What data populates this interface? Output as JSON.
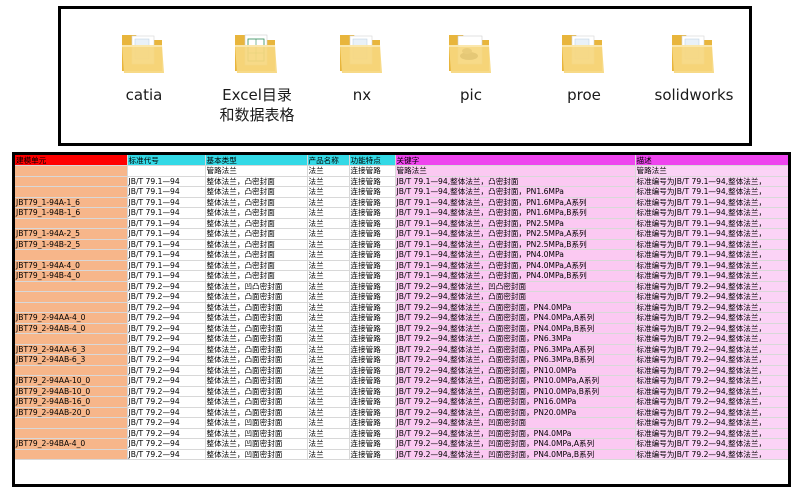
{
  "folders": [
    {
      "label": "catia",
      "icon": "folder-icon"
    },
    {
      "label": "Excel目录\n和数据表格",
      "icon": "folder-icon"
    },
    {
      "label": "nx",
      "icon": "folder-icon"
    },
    {
      "label": "pic",
      "icon": "folder-icon"
    },
    {
      "label": "proe",
      "icon": "folder-icon"
    },
    {
      "label": "solidworks",
      "icon": "folder-icon"
    }
  ],
  "colors": {
    "folder_back": "#e8b53c",
    "folder_front": "#f6d77e",
    "col_a_bg": "#f7b68a",
    "header_red": "#ff0000",
    "header_cyan": "#33d9e6",
    "header_magenta": "#ee44ee",
    "pink_bg": "#fbc9f2"
  },
  "sheet": {
    "headers": [
      "建模单元",
      "标准代号",
      "基本类型",
      "产品名称",
      "功能特点",
      "关键字",
      "描述"
    ],
    "rows": [
      [
        "",
        "",
        "管路法兰",
        "法兰",
        "连接管路",
        "管路法兰",
        "管路法兰"
      ],
      [
        "",
        "JB/T 79.1—94",
        "整体法兰，凸密封面",
        "法兰",
        "连接管路",
        "JB/T 79.1—94,整体法兰，凸密封面",
        "标准编号为JB/T 79.1—94,整体法兰，"
      ],
      [
        "",
        "JB/T 79.1—94",
        "整体法兰，凸密封面",
        "法兰",
        "连接管路",
        "JB/T 79.1—94,整体法兰，凸密封面，PN1.6MPa",
        "标准编号为JB/T 79.1—94,整体法兰，"
      ],
      [
        "JBT79_1-94A-1_6",
        "JB/T 79.1—94",
        "整体法兰，凸密封面",
        "法兰",
        "连接管路",
        "JB/T 79.1—94,整体法兰，凸密封面，PN1.6MPa,A系列",
        "标准编号为JB/T 79.1—94,整体法兰，"
      ],
      [
        "JBT79_1-94B-1_6",
        "JB/T 79.1—94",
        "整体法兰，凸密封面",
        "法兰",
        "连接管路",
        "JB/T 79.1—94,整体法兰，凸密封面，PN1.6MPa,B系列",
        "标准编号为JB/T 79.1—94,整体法兰，"
      ],
      [
        "",
        "JB/T 79.1—94",
        "整体法兰，凸密封面",
        "法兰",
        "连接管路",
        "JB/T 79.1—94,整体法兰，凸密封面，PN2.5MPa",
        "标准编号为JB/T 79.1—94,整体法兰，"
      ],
      [
        "JBT79_1-94A-2_5",
        "JB/T 79.1—94",
        "整体法兰，凸密封面",
        "法兰",
        "连接管路",
        "JB/T 79.1—94,整体法兰，凸密封面，PN2.5MPa,A系列",
        "标准编号为JB/T 79.1—94,整体法兰，"
      ],
      [
        "JBT79_1-94B-2_5",
        "JB/T 79.1—94",
        "整体法兰，凸密封面",
        "法兰",
        "连接管路",
        "JB/T 79.1—94,整体法兰，凸密封面，PN2.5MPa,B系列",
        "标准编号为JB/T 79.1—94,整体法兰，"
      ],
      [
        "",
        "JB/T 79.1—94",
        "整体法兰，凸密封面",
        "法兰",
        "连接管路",
        "JB/T 79.1—94,整体法兰，凸密封面，PN4.0MPa",
        "标准编号为JB/T 79.1—94,整体法兰，"
      ],
      [
        "JBT79_1-94A-4_0",
        "JB/T 79.1—94",
        "整体法兰，凸密封面",
        "法兰",
        "连接管路",
        "JB/T 79.1—94,整体法兰，凸密封面，PN4.0MPa,A系列",
        "标准编号为JB/T 79.1—94,整体法兰，"
      ],
      [
        "JBT79_1-94B-4_0",
        "JB/T 79.1—94",
        "整体法兰，凸密封面",
        "法兰",
        "连接管路",
        "JB/T 79.1—94,整体法兰，凸密封面，PN4.0MPa,B系列",
        "标准编号为JB/T 79.1—94,整体法兰，"
      ],
      [
        "",
        "JB/T 79.2—94",
        "整体法兰，凹凸密封面",
        "法兰",
        "连接管路",
        "JB/T 79.2—94,整体法兰，凹凸密封面",
        "标准编号为JB/T 79.2—94,整体法兰，"
      ],
      [
        "",
        "JB/T 79.2—94",
        "整体法兰，凸面密封面",
        "法兰",
        "连接管路",
        "JB/T 79.2—94,整体法兰，凸面密封面",
        "标准编号为JB/T 79.2—94,整体法兰，"
      ],
      [
        "",
        "JB/T 79.2—94",
        "整体法兰，凸面密封面",
        "法兰",
        "连接管路",
        "JB/T 79.2—94,整体法兰，凸面密封面，PN4.0MPa",
        "标准编号为JB/T 79.2—94,整体法兰，"
      ],
      [
        "JBT79_2-94AA-4_0",
        "JB/T 79.2—94",
        "整体法兰，凸面密封面",
        "法兰",
        "连接管路",
        "JB/T 79.2—94,整体法兰，凸面密封面，PN4.0MPa,A系列",
        "标准编号为JB/T 79.2—94,整体法兰，"
      ],
      [
        "JBT79_2-94AB-4_0",
        "JB/T 79.2—94",
        "整体法兰，凸面密封面",
        "法兰",
        "连接管路",
        "JB/T 79.2—94,整体法兰，凸面密封面，PN4.0MPa,B系列",
        "标准编号为JB/T 79.2—94,整体法兰，"
      ],
      [
        "",
        "JB/T 79.2—94",
        "整体法兰，凸面密封面",
        "法兰",
        "连接管路",
        "JB/T 79.2—94,整体法兰，凸面密封面，PN6.3MPa",
        "标准编号为JB/T 79.2—94,整体法兰，"
      ],
      [
        "JBT79_2-94AA-6_3",
        "JB/T 79.2—94",
        "整体法兰，凸面密封面",
        "法兰",
        "连接管路",
        "JB/T 79.2—94,整体法兰，凸面密封面，PN6.3MPa,A系列",
        "标准编号为JB/T 79.2—94,整体法兰，"
      ],
      [
        "JBT79_2-94AB-6_3",
        "JB/T 79.2—94",
        "整体法兰，凸面密封面",
        "法兰",
        "连接管路",
        "JB/T 79.2—94,整体法兰，凸面密封面，PN6.3MPa,B系列",
        "标准编号为JB/T 79.2—94,整体法兰，"
      ],
      [
        "",
        "JB/T 79.2—94",
        "整体法兰，凸面密封面",
        "法兰",
        "连接管路",
        "JB/T 79.2—94,整体法兰，凸面密封面，PN10.0MPa",
        "标准编号为JB/T 79.2—94,整体法兰，"
      ],
      [
        "JBT79_2-94AA-10_0",
        "JB/T 79.2—94",
        "整体法兰，凸面密封面",
        "法兰",
        "连接管路",
        "JB/T 79.2—94,整体法兰，凸面密封面，PN10.0MPa,A系列",
        "标准编号为JB/T 79.2—94,整体法兰，"
      ],
      [
        "JBT79_2-94AB-10_0",
        "JB/T 79.2—94",
        "整体法兰，凸面密封面",
        "法兰",
        "连接管路",
        "JB/T 79.2—94,整体法兰，凸面密封面，PN10.0MPa,B系列",
        "标准编号为JB/T 79.2—94,整体法兰，"
      ],
      [
        "JBT79_2-94AB-16_0",
        "JB/T 79.2—94",
        "整体法兰，凸面密封面",
        "法兰",
        "连接管路",
        "JB/T 79.2—94,整体法兰，凸面密封面，PN16.0MPa",
        "标准编号为JB/T 79.2—94,整体法兰，"
      ],
      [
        "JBT79_2-94AB-20_0",
        "JB/T 79.2—94",
        "整体法兰，凸面密封面",
        "法兰",
        "连接管路",
        "JB/T 79.2—94,整体法兰，凸面密封面，PN20.0MPa",
        "标准编号为JB/T 79.2—94,整体法兰，"
      ],
      [
        "",
        "JB/T 79.2—94",
        "整体法兰，凹面密封面",
        "法兰",
        "连接管路",
        "JB/T 79.2—94,整体法兰，凹面密封面",
        "标准编号为JB/T 79.2—94,整体法兰，"
      ],
      [
        "",
        "JB/T 79.2—94",
        "整体法兰，凹面密封面",
        "法兰",
        "连接管路",
        "JB/T 79.2—94,整体法兰，凹面密封面，PN4.0MPa",
        "标准编号为JB/T 79.2—94,整体法兰，"
      ],
      [
        "JBT79_2-94BA-4_0",
        "JB/T 79.2—94",
        "整体法兰，凹面密封面",
        "法兰",
        "连接管路",
        "JB/T 79.2—94,整体法兰，凹面密封面，PN4.0MPa,A系列",
        "标准编号为JB/T 79.2—94,整体法兰，"
      ],
      [
        "",
        "JB/T 79.2—94",
        "整体法兰，凹面密封面",
        "法兰",
        "连接管路",
        "JB/T 79.2—94,整体法兰，凹面密封面，PN4.0MPa,B系列",
        "标准编号为JB/T 79.2—94,整体法兰，"
      ]
    ]
  }
}
